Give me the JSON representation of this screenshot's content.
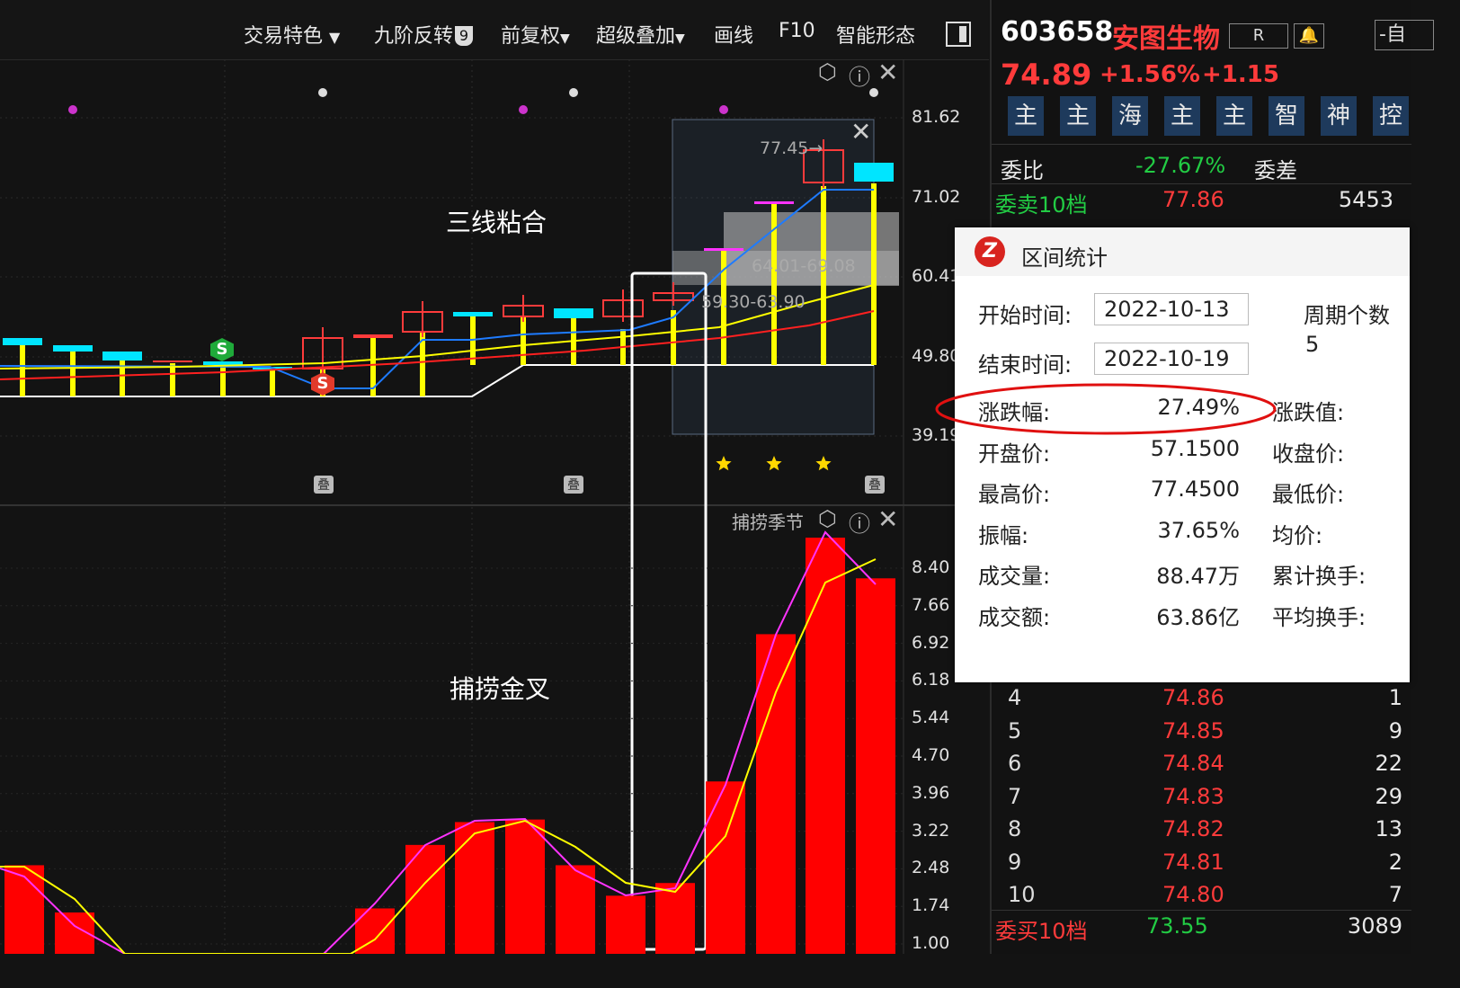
{
  "toolbar": {
    "items": [
      "交易特色",
      "九阶反转",
      "前复权",
      "超级叠加",
      "画线",
      "F10",
      "智能形态"
    ],
    "nine_badge": "9"
  },
  "chart_data": [
    {
      "type": "candlestick",
      "pane": "main",
      "annotation": "三线粘合",
      "yticks": [
        81.62,
        71.02,
        60.41,
        49.8,
        39.19
      ],
      "ylim": [
        39.19,
        81.62
      ],
      "highlight_high_label": "77.45→",
      "zone_labels": [
        "64.01-69.08",
        "59.30-63.90"
      ],
      "marker_label": "S",
      "overlay_glyph": "叠",
      "colors": {
        "up": "#ff3b3b",
        "down": "#00e5ff",
        "ma_short": "#1e7bff",
        "ma_mid": "#ffff00",
        "ma_long": "#ff2020"
      }
    },
    {
      "type": "bar",
      "pane": "indicator",
      "title": "捕捞季节",
      "annotation": "捕捞金叉",
      "yticks": [
        8.4,
        7.66,
        6.92,
        6.18,
        5.44,
        4.7,
        3.96,
        3.22,
        2.48,
        1.74,
        1.0
      ],
      "ylim": [
        1.0,
        8.4
      ],
      "values": [
        2.55,
        1.62,
        0.3,
        0.3,
        0.3,
        0.3,
        0.3,
        1.7,
        2.95,
        3.4,
        3.45,
        2.55,
        1.95,
        2.2,
        4.2,
        7.1,
        9.0,
        8.2
      ],
      "colors": {
        "bar": "#ff0000",
        "line1": "#ff33ff",
        "line2": "#ffff00"
      }
    }
  ],
  "quote": {
    "code": "603658",
    "name": "安图生物",
    "r_button": "R",
    "self_button": "-自",
    "price": "74.89",
    "pct": "+1.56%",
    "change": "+1.15",
    "badges": [
      "主",
      "主",
      "海",
      "主",
      "主",
      "智",
      "神",
      "控"
    ],
    "weibi_label": "委比",
    "weibi_value": "-27.67%",
    "weicha_label": "委差",
    "sell10_label": "委卖10档",
    "sell10_price": "77.86",
    "sell10_vol": "5453",
    "buy_rows": [
      {
        "lvl": "4",
        "price": "74.86",
        "vol": "1"
      },
      {
        "lvl": "5",
        "price": "74.85",
        "vol": "9"
      },
      {
        "lvl": "6",
        "price": "74.84",
        "vol": "22"
      },
      {
        "lvl": "7",
        "price": "74.83",
        "vol": "29"
      },
      {
        "lvl": "8",
        "price": "74.82",
        "vol": "13"
      },
      {
        "lvl": "9",
        "price": "74.81",
        "vol": "2"
      },
      {
        "lvl": "10",
        "price": "74.80",
        "vol": "7"
      }
    ],
    "buy10_label": "委买10档",
    "buy10_price": "73.55",
    "buy10_vol": "3089"
  },
  "stats_dialog": {
    "title": "区间统计",
    "start_label": "开始时间:",
    "start_value": "2022-10-13",
    "end_label": "结束时间:",
    "end_value": "2022-10-19",
    "period_label": "周期个数",
    "period_value": "5",
    "rows": [
      {
        "label": "涨跌幅:",
        "value": "27.49%",
        "right": "涨跌值:"
      },
      {
        "label": "开盘价:",
        "value": "57.1500",
        "right": "收盘价:"
      },
      {
        "label": "最高价:",
        "value": "77.4500",
        "right": "最低价:"
      },
      {
        "label": "振幅:",
        "value": "37.65%",
        "right": "均价:"
      },
      {
        "label": "成交量:",
        "value": "88.47万",
        "right": "累计换手:"
      },
      {
        "label": "成交额:",
        "value": "63.86亿",
        "right": "平均换手:"
      }
    ]
  }
}
